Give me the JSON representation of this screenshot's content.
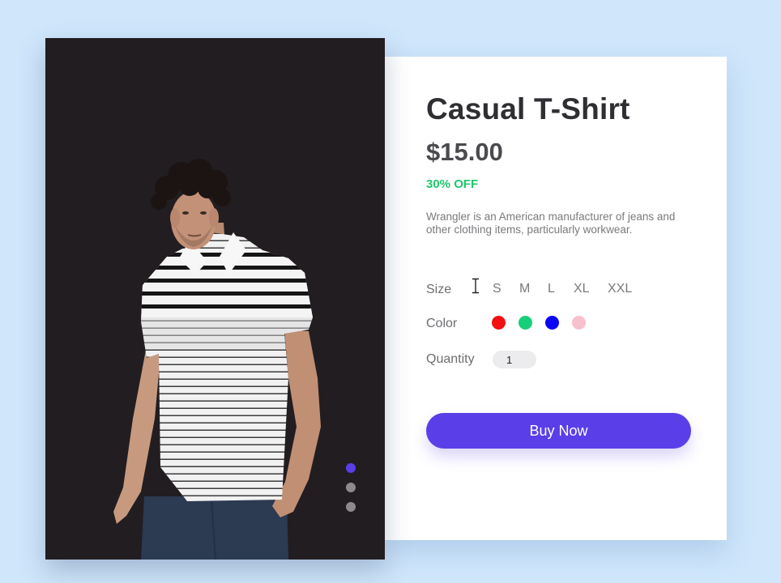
{
  "product": {
    "title": "Casual T-Shirt",
    "price": "$15.00",
    "discount": "30% OFF",
    "description": "Wrangler is an American manufacturer of jeans and other clothing items, particularly workwear.",
    "image_icon": "man-in-striped-polo-tshirt"
  },
  "options": {
    "size_label": "Size",
    "sizes": [
      "S",
      "M",
      "L",
      "XL",
      "XXL"
    ],
    "color_label": "Color",
    "colors": [
      "#f20f13",
      "#16cf7a",
      "#0b05f5",
      "#f8bfcd"
    ],
    "quantity_label": "Quantity",
    "quantity_value": "1"
  },
  "actions": {
    "buy_label": "Buy Now"
  },
  "carousel": {
    "active_index": 0,
    "count": 3,
    "active_color": "#5a3fe8",
    "inactive_color": "#8c8a8d"
  },
  "theme": {
    "page_background": "#cfe6fb",
    "accent": "#5a3fe8",
    "discount_color": "#1fc76b"
  }
}
